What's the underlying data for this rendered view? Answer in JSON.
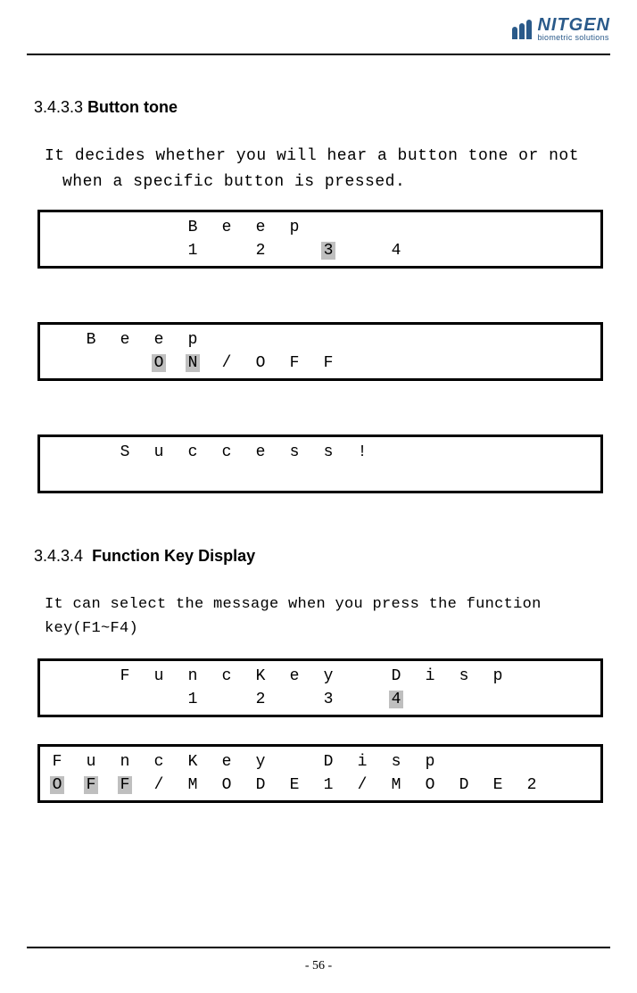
{
  "logo": {
    "name": "NITGEN",
    "tagline": "biometric solutions"
  },
  "section1": {
    "num": "3.4.3.3",
    "title": "Button tone",
    "body": "It decides whether you will hear a button tone or not when a specific button is pressed."
  },
  "lcd1": {
    "row1": [
      "",
      "",
      "",
      "",
      "B",
      "e",
      "e",
      "p",
      "",
      "",
      "",
      "",
      "",
      "",
      "",
      ""
    ],
    "row2": [
      "",
      "",
      "",
      "",
      "1",
      "",
      "2",
      "",
      "",
      "",
      "4",
      "",
      "",
      "",
      "",
      ""
    ],
    "row2_hl": "3"
  },
  "lcd2": {
    "row1": [
      "",
      "B",
      "e",
      "e",
      "p",
      "",
      "",
      "",
      "",
      "",
      "",
      "",
      "",
      "",
      "",
      ""
    ],
    "row2_hl": [
      "O",
      "N"
    ],
    "row2_rest": [
      "/",
      "O",
      "F",
      "F",
      "",
      "",
      "",
      "",
      "",
      "",
      ""
    ]
  },
  "lcd3": {
    "row1": [
      "",
      "",
      "S",
      "u",
      "c",
      "c",
      "e",
      "s",
      "s",
      "!",
      "",
      "",
      "",
      "",
      "",
      ""
    ]
  },
  "section2": {
    "num": "3.4.3.4",
    "title": "Function Key Display",
    "body": "It can select the message when you press the function key(F1~F4)"
  },
  "lcd4": {
    "row1": [
      "",
      "",
      "F",
      "u",
      "n",
      "c",
      "K",
      "e",
      "y",
      "",
      "D",
      "i",
      "s",
      "p",
      "",
      ""
    ],
    "row2": [
      "",
      "",
      "",
      "",
      "1",
      "",
      "2",
      "",
      "3",
      "",
      "",
      "",
      "",
      "",
      "",
      ""
    ],
    "row2_hl": "4"
  },
  "lcd5": {
    "row1": [
      "F",
      "u",
      "n",
      "c",
      "K",
      "e",
      "y",
      "",
      "D",
      "i",
      "s",
      "p",
      "",
      "",
      "",
      ""
    ],
    "row2_hl": [
      "O",
      "F",
      "F"
    ],
    "row2_a": "/",
    "row2_b": [
      "M",
      "O",
      "D",
      "E",
      "1",
      "/",
      "M",
      "O",
      "D",
      "E",
      "2"
    ]
  },
  "page": "- 56 -"
}
